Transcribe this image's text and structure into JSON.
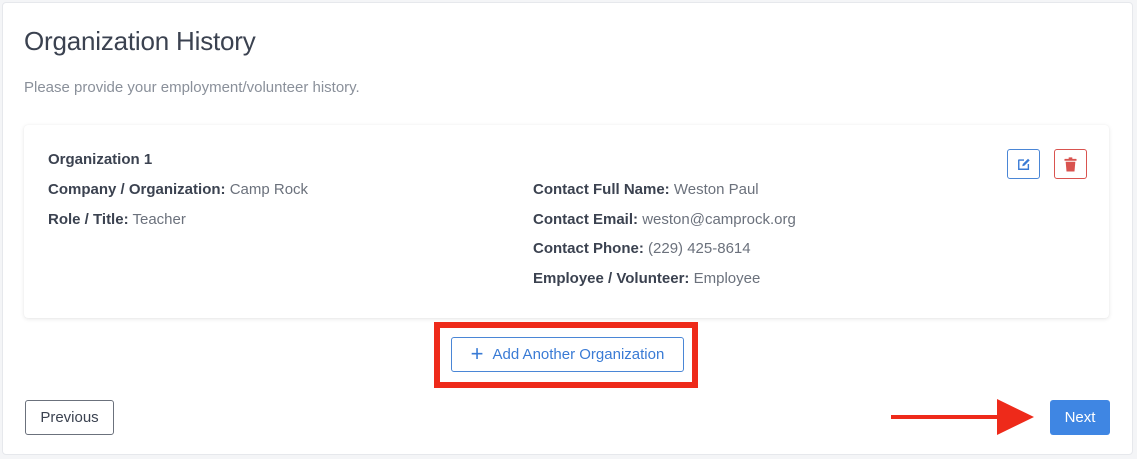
{
  "page": {
    "title": "Organization History",
    "subtitle": "Please provide your employment/volunteer history."
  },
  "organization": {
    "heading": "Organization 1",
    "company_label": "Company / Organization:",
    "company_value": "Camp Rock",
    "role_label": "Role / Title:",
    "role_value": "Teacher",
    "contact_name_label": "Contact Full Name:",
    "contact_name_value": "Weston Paul",
    "contact_email_label": "Contact Email:",
    "contact_email_value": "weston@camprock.org",
    "contact_phone_label": "Contact Phone:",
    "contact_phone_value": "(229) 425-8614",
    "type_label": "Employee / Volunteer:",
    "type_value": "Employee",
    "edit_icon": "edit-icon",
    "delete_icon": "trash-icon"
  },
  "actions": {
    "add_label": "Add Another Organization",
    "previous_label": "Previous",
    "next_label": "Next"
  },
  "colors": {
    "accent": "#3f86e3",
    "danger": "#d9534f",
    "annotation": "#ee2a1a"
  }
}
